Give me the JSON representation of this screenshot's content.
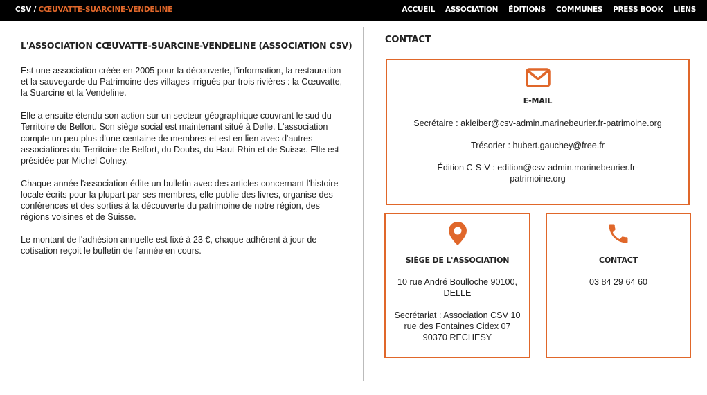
{
  "header": {
    "brand_prefix": "CSV / ",
    "brand_name": "CŒUVATTE-SUARCINE-VENDELINE",
    "nav": [
      "ACCUEIL",
      "ASSOCIATION",
      "ÉDITIONS",
      "COMMUNES",
      "PRESS BOOK",
      "LIENS"
    ]
  },
  "association": {
    "title": "L'ASSOCIATION CŒUVATTE-SUARCINE-VENDELINE (ASSOCIATION CSV)",
    "paragraphs": [
      "Est une association créée en 2005 pour la découverte, l'information, la restauration et la sauvegarde du Patrimoine des villages irrigués par trois rivières : la Cœuvatte, la Suarcine et la Vendeline.",
      "Elle a ensuite étendu son action sur un secteur géographique couvrant le sud du Territoire de Belfort. Son siège social est maintenant situé à Delle. L'association compte un peu plus d'une centaine de membres et est en lien avec d'autres associations du Territoire de Belfort, du Doubs, du Haut-Rhin et de Suisse. Elle est présidée par Michel Colney.",
      "Chaque année l'association édite un bulletin avec des articles concernant l'histoire locale écrits pour la plupart par ses membres, elle publie des livres, organise des conférences et des sorties à la découverte du patrimoine de notre région, des régions voisines et de Suisse.",
      "Le montant de l'adhésion annuelle est fixé à 23 €, chaque adhérent à jour de cotisation reçoit le bulletin de l'année en cours."
    ]
  },
  "contact": {
    "title": "CONTACT",
    "email_box": {
      "icon": "envelope-icon",
      "title": "E-MAIL",
      "lines": [
        "Secrétaire : akleiber@csv-admin.marinebeurier.fr-patrimoine.org",
        "Trésorier : hubert.gauchey@free.fr",
        "Édition C-S-V : edition@csv-admin.marinebeurier.fr-patrimoine.org"
      ]
    },
    "siege_box": {
      "icon": "map-pin-icon",
      "title": "SIÈGE DE L'ASSOCIATION",
      "address": "10 rue André Boulloche 90100, DELLE",
      "secretariat": "Secrétariat : Association CSV 10 rue des Fontaines Cidex 07 90370 RECHESY"
    },
    "phone_box": {
      "icon": "phone-icon",
      "title": "CONTACT",
      "phone": "03 84 29 64 60"
    }
  },
  "colors": {
    "accent": "#e0672a",
    "topbar": "#000000",
    "divider": "#bbbbbb"
  }
}
